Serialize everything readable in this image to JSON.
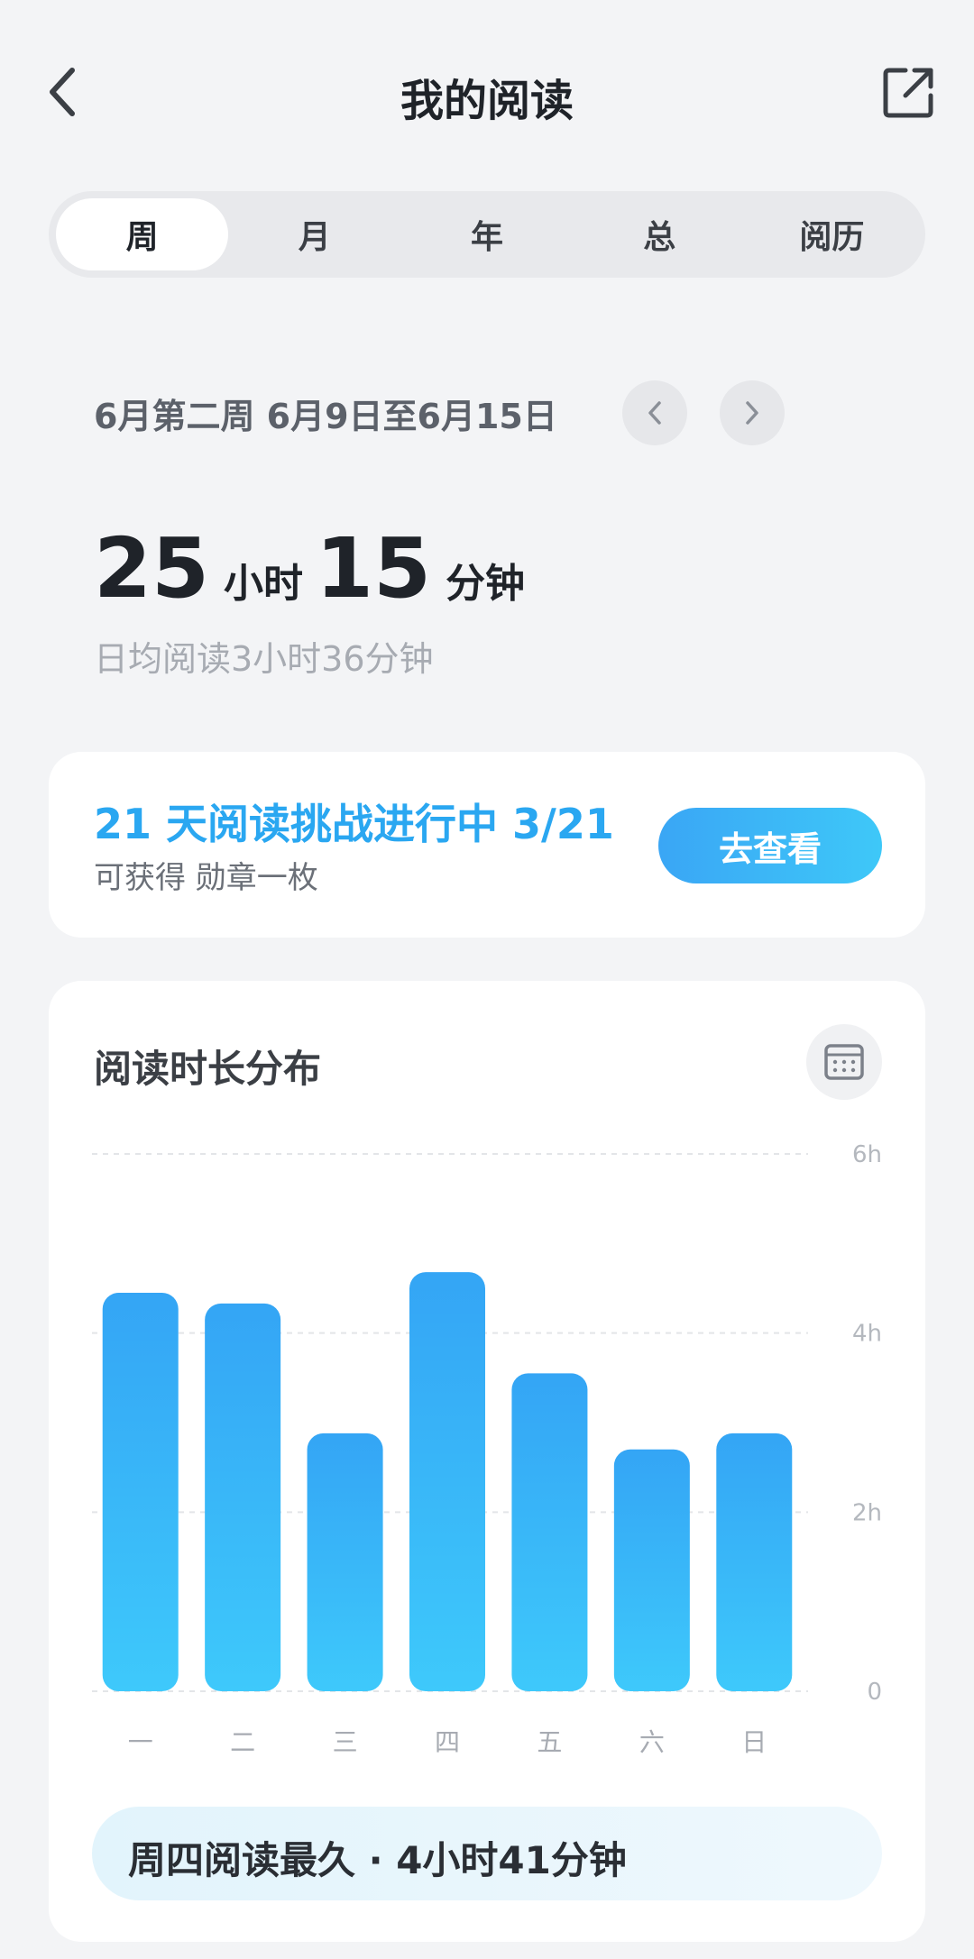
{
  "header": {
    "title": "我的阅读",
    "back_icon": "chevron-left-icon",
    "share_icon": "external-link-icon"
  },
  "tabs": [
    {
      "label": "周",
      "active": true
    },
    {
      "label": "月",
      "active": false
    },
    {
      "label": "年",
      "active": false
    },
    {
      "label": "总",
      "active": false
    },
    {
      "label": "阅历",
      "active": false
    }
  ],
  "week": {
    "range_text": "6月第二周 6月9日至6月15日"
  },
  "summary": {
    "hours": "25",
    "hours_unit": "小时",
    "minutes": "15",
    "minutes_unit": "分钟",
    "daily_avg": "日均阅读3小时36分钟"
  },
  "challenge": {
    "title": "21 天阅读挑战进行中 3/21",
    "subtitle": "可获得 勋章一枚",
    "button_label": "去查看",
    "accent_color": "#2aa7f1"
  },
  "chart_card": {
    "title": "阅读时长分布",
    "calendar_icon": "calendar-icon",
    "summary_text": "周四阅读最久 · 4小时41分钟"
  },
  "chart_data": {
    "type": "bar",
    "categories": [
      "一",
      "二",
      "三",
      "四",
      "五",
      "六",
      "日"
    ],
    "values": [
      4.45,
      4.33,
      2.88,
      4.68,
      3.55,
      2.7,
      2.88
    ],
    "ylim": [
      0,
      6
    ],
    "y_ticks": [
      {
        "value": 0,
        "label": "0"
      },
      {
        "value": 2,
        "label": "2h"
      },
      {
        "value": 4,
        "label": "4h"
      },
      {
        "value": 6,
        "label": "6h"
      }
    ],
    "grid": true,
    "bar_color_top": "#34a5f5",
    "bar_color_bottom": "#3ec9fb"
  }
}
